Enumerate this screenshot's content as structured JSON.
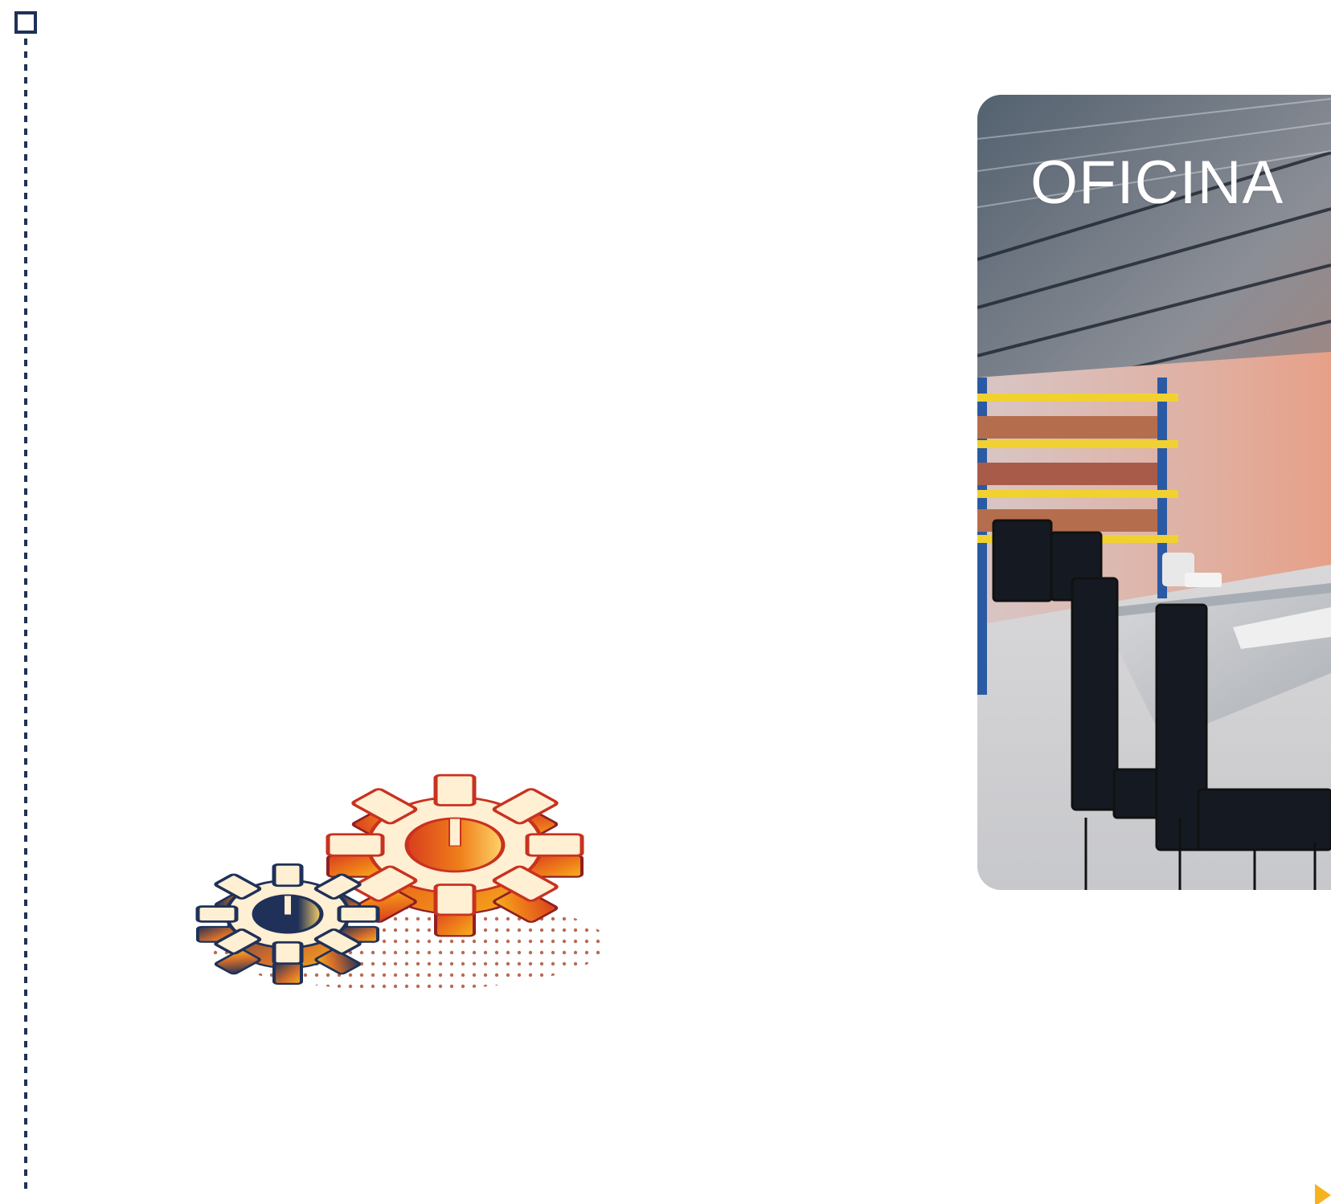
{
  "card": {
    "title": "OFICINA"
  },
  "icons": {
    "gears": "gears-icon",
    "corner_marker": "corner-square-icon",
    "arrow": "arrow-right-icon"
  },
  "colors": {
    "navy": "#1f3158",
    "red": "#c8321f",
    "orange": "#ef7f1a",
    "yellow": "#f5b31e",
    "cream": "#fff0d6",
    "photo_ceiling": "#5d6470",
    "photo_wall": "#d5a294"
  }
}
